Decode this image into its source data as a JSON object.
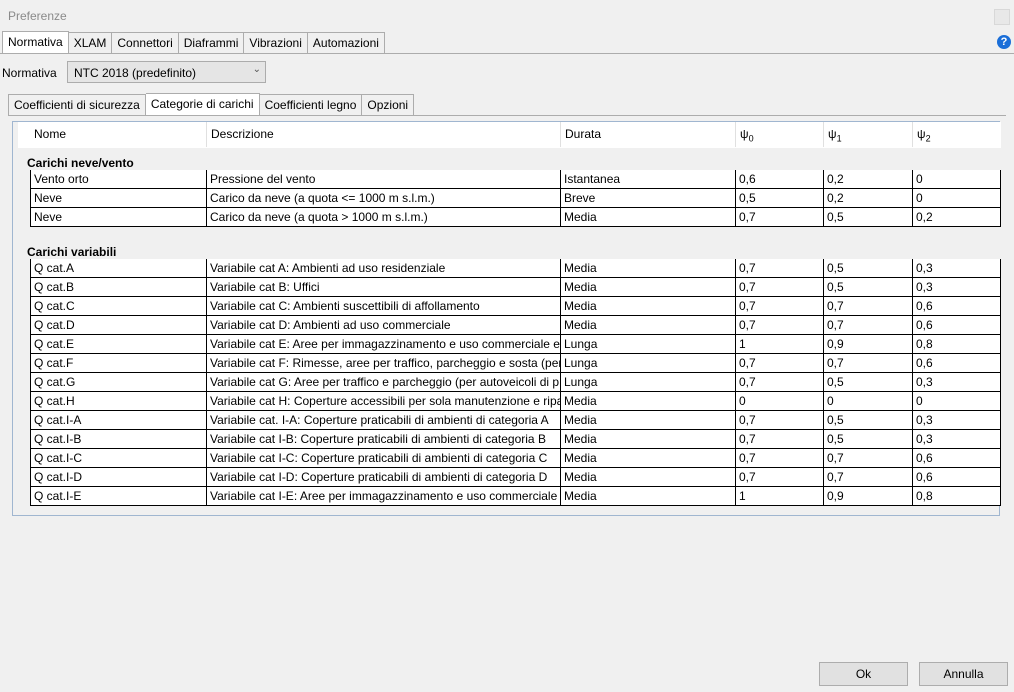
{
  "window": {
    "title": "Preferenze"
  },
  "main_tabs": [
    {
      "label": "Normativa",
      "active": true
    },
    {
      "label": "XLAM",
      "active": false
    },
    {
      "label": "Connettori",
      "active": false
    },
    {
      "label": "Diaframmi",
      "active": false
    },
    {
      "label": "Vibrazioni",
      "active": false
    },
    {
      "label": "Automazioni",
      "active": false
    }
  ],
  "normativa": {
    "label": "Normativa",
    "selected": "NTC 2018 (predefinito)"
  },
  "sub_tabs": [
    {
      "label": "Coefficienti di sicurezza",
      "active": false
    },
    {
      "label": "Categorie di carichi",
      "active": true
    },
    {
      "label": "Coefficienti legno",
      "active": false
    },
    {
      "label": "Opzioni",
      "active": false
    }
  ],
  "table": {
    "headers": {
      "nome": "Nome",
      "descrizione": "Descrizione",
      "durata": "Durata",
      "psi0": "ψ",
      "psi1": "ψ",
      "psi2": "ψ",
      "psi0_sub": "0",
      "psi1_sub": "1",
      "psi2_sub": "2"
    },
    "groups": [
      {
        "title": "Carichi neve/vento",
        "rows": [
          [
            "Vento orto",
            "Pressione del vento",
            "Istantanea",
            "0,6",
            "0,2",
            "0"
          ],
          [
            "Neve",
            "Carico da neve (a quota <= 1000 m s.l.m.)",
            "Breve",
            "0,5",
            "0,2",
            "0"
          ],
          [
            "Neve",
            "Carico da neve (a quota > 1000 m s.l.m.)",
            "Media",
            "0,7",
            "0,5",
            "0,2"
          ]
        ]
      },
      {
        "title": "Carichi variabili",
        "rows": [
          [
            "Q cat.A",
            "Variabile cat A: Ambienti ad uso residenziale",
            "Media",
            "0,7",
            "0,5",
            "0,3"
          ],
          [
            "Q cat.B",
            "Variabile cat B: Uffici",
            "Media",
            "0,7",
            "0,5",
            "0,3"
          ],
          [
            "Q cat.C",
            "Variabile cat C: Ambienti suscettibili di affollamento",
            "Media",
            "0,7",
            "0,7",
            "0,6"
          ],
          [
            "Q cat.D",
            "Variabile cat D: Ambienti ad uso commerciale",
            "Media",
            "0,7",
            "0,7",
            "0,6"
          ],
          [
            "Q cat.E",
            "Variabile cat E: Aree per immagazzinamento e uso commerciale ed",
            "Lunga",
            "1",
            "0,9",
            "0,8"
          ],
          [
            "Q cat.F",
            "Variabile cat F: Rimesse, aree per traffico, parcheggio e sosta (per",
            "Lunga",
            "0,7",
            "0,7",
            "0,6"
          ],
          [
            "Q cat.G",
            "Variabile cat G: Aree per traffico e parcheggio (per autoveicoli di p",
            "Lunga",
            "0,7",
            "0,5",
            "0,3"
          ],
          [
            "Q cat.H",
            "Variabile cat H: Coperture accessibili per sola manutenzione e ripa",
            "Media",
            "0",
            "0",
            "0"
          ],
          [
            "Q cat.I-A",
            "Variabile cat. I-A: Coperture praticabili di ambienti di categoria A",
            "Media",
            "0,7",
            "0,5",
            "0,3"
          ],
          [
            "Q cat.I-B",
            "Variabile cat I-B: Coperture praticabili di ambienti di categoria B",
            "Media",
            "0,7",
            "0,5",
            "0,3"
          ],
          [
            "Q cat.I-C",
            "Variabile cat I-C: Coperture praticabili di ambienti di categoria C",
            "Media",
            "0,7",
            "0,7",
            "0,6"
          ],
          [
            "Q cat.I-D",
            "Variabile cat I-D: Coperture praticabili di ambienti di categoria D",
            "Media",
            "0,7",
            "0,7",
            "0,6"
          ],
          [
            "Q cat.I-E",
            "Variabile cat I-E: Aree per immagazzinamento e uso commerciale",
            "Media",
            "1",
            "0,9",
            "0,8"
          ]
        ]
      }
    ]
  },
  "buttons": {
    "ok": "Ok",
    "cancel": "Annulla"
  },
  "icons": {
    "help": "help-icon",
    "close": "close-icon",
    "dropdown": "chevron-down-icon"
  },
  "colors": {
    "help_blue": "#1a6ed8",
    "panel_border": "#a0b6d0"
  }
}
